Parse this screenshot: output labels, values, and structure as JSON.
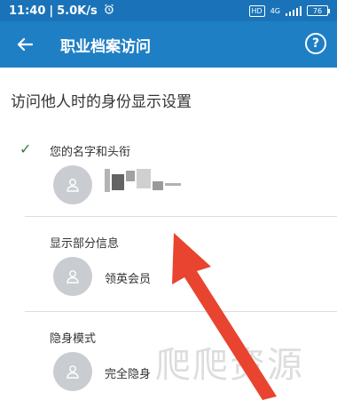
{
  "status_bar": {
    "time": "11:40",
    "speed": "5.0K/s",
    "alarm_icon": "alarm-icon",
    "hd_label": "HD",
    "net_label": "4G",
    "battery": "76"
  },
  "appbar": {
    "title": "职业档案访问",
    "back_icon": "back-arrow-icon",
    "help_icon": "help-icon",
    "help_glyph": "?"
  },
  "section_title": "访问他人时的身份显示设置",
  "options": [
    {
      "label": "您的名字和头衔",
      "value": "",
      "selected": true
    },
    {
      "label": "显示部分信息",
      "value": "领英会员",
      "selected": false
    },
    {
      "label": "隐身模式",
      "value": "完全隐身",
      "selected": false
    }
  ],
  "check_glyph": "✓",
  "watermark": "爬爬资源",
  "colors": {
    "appbar": "#1f7fc4",
    "status": "#1a73b8",
    "check": "#2e7d32",
    "arrow": "#e8442f"
  }
}
